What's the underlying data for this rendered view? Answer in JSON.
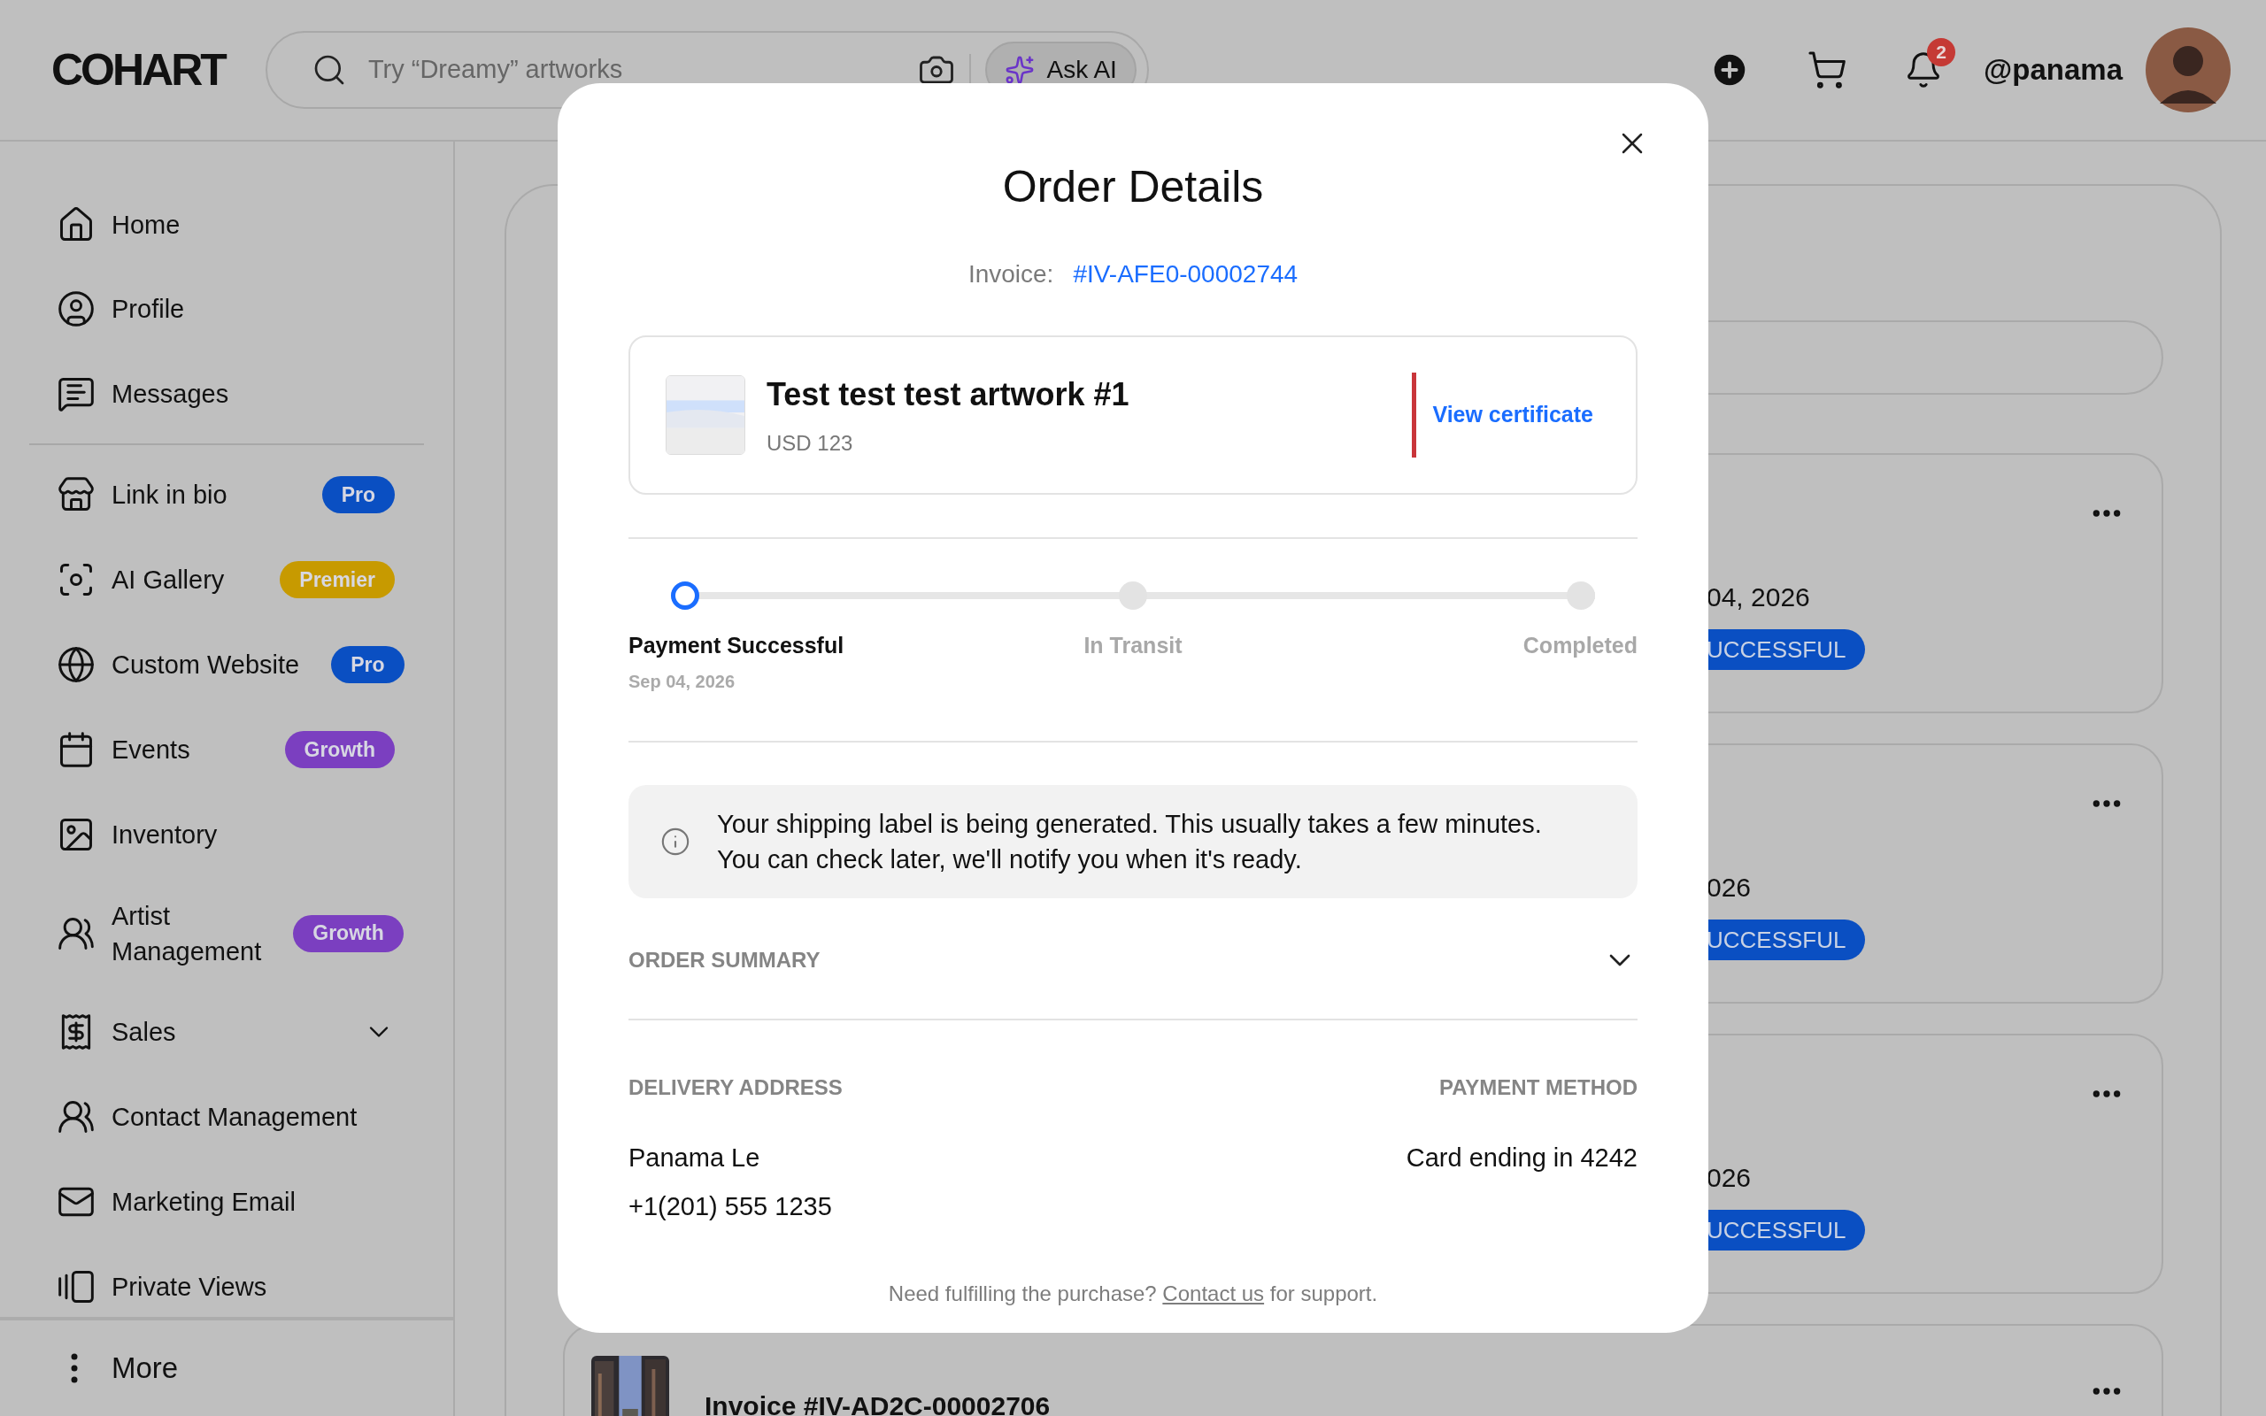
{
  "header": {
    "logo": "COHART",
    "search": {
      "placeholder": "Try “Dreamy” artworks"
    },
    "ask_ai": "Ask AI",
    "notifications": "2",
    "username": "@panama"
  },
  "sidebar": {
    "items": [
      {
        "label": "Home"
      },
      {
        "label": "Profile"
      },
      {
        "label": "Messages"
      }
    ],
    "tools": [
      {
        "label": "Link in bio",
        "badge": {
          "label": "Pro",
          "color": "#0a4fc2"
        }
      },
      {
        "label": "AI Gallery",
        "badge": {
          "label": "Premier",
          "color": "#c79a00"
        }
      },
      {
        "label": "Custom Website",
        "badge": {
          "label": "Pro",
          "color": "#0a4fc2"
        }
      },
      {
        "label": "Events",
        "badge": {
          "label": "Growth",
          "color": "#7b3fc0"
        }
      },
      {
        "label": "Inventory"
      },
      {
        "label": "Artist Management",
        "badge": {
          "label": "Growth",
          "color": "#7b3fc0"
        }
      },
      {
        "label": "Sales",
        "expanded": false
      },
      {
        "label": "Contact Management"
      },
      {
        "label": "Marketing Email"
      },
      {
        "label": "Private Views"
      }
    ],
    "more": "More"
  },
  "orders": [
    {
      "date": "04, 2026",
      "status": "UCCESSFUL"
    },
    {
      "date": "026",
      "status": "UCCESSFUL"
    },
    {
      "date": "026",
      "status": "UCCESSFUL"
    }
  ],
  "last_order": {
    "title": "Invoice #IV-AD2C-00002706"
  },
  "modal": {
    "title": "Order Details",
    "invoice_label": "Invoice:",
    "invoice": "#IV-AFE0-00002744",
    "artwork": {
      "title": "Test test test artwork #1",
      "price": "USD 123",
      "certificate": "View certificate"
    },
    "steps": [
      {
        "label": "Payment Successful",
        "date": "Sep 04, 2026",
        "active": true
      },
      {
        "label": "In Transit",
        "active": false
      },
      {
        "label": "Completed",
        "active": false
      }
    ],
    "notice": "Your shipping label is being generated. This usually takes a few minutes. You can check later, we'll notify you when it's ready.",
    "order_summary": {
      "label": "ORDER SUMMARY",
      "expanded": false
    },
    "delivery": {
      "label": "DELIVERY ADDRESS",
      "name": "Panama Le",
      "phone": "+1(201) 555 1235"
    },
    "payment": {
      "label": "PAYMENT METHOD",
      "value": "Card ending in 4242"
    },
    "footer": {
      "before": "Need fulfilling the purchase?",
      "link": "Contact us",
      "after": "for support."
    }
  }
}
